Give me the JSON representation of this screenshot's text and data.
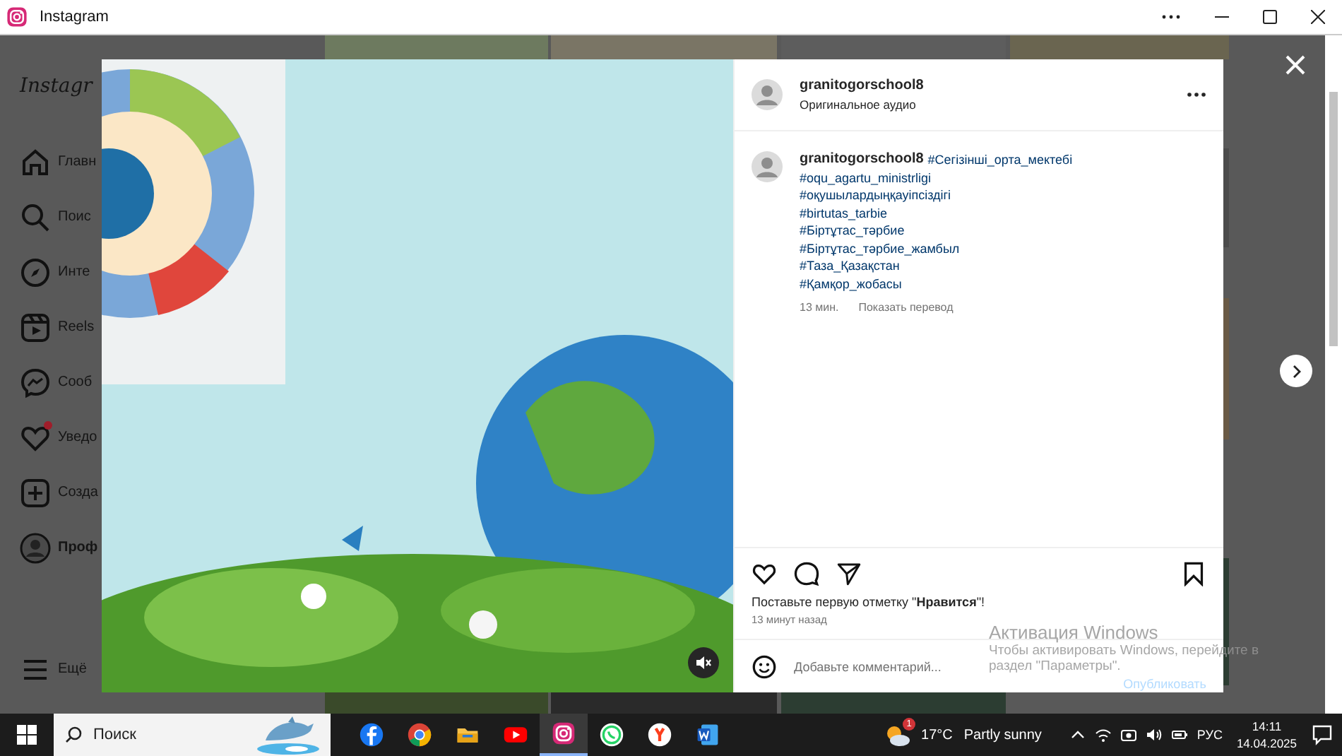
{
  "window": {
    "title": "Instagram"
  },
  "sidebar": {
    "logo": "Instagr",
    "items": [
      {
        "label": "Главн",
        "kind": "home",
        "selected": false,
        "dot": false
      },
      {
        "label": "Поис",
        "kind": "search",
        "selected": false,
        "dot": false
      },
      {
        "label": "Инте",
        "kind": "compass",
        "selected": false,
        "dot": false
      },
      {
        "label": "Reels",
        "kind": "reels",
        "selected": false,
        "dot": false
      },
      {
        "label": "Сооб",
        "kind": "messenger",
        "selected": false,
        "dot": false
      },
      {
        "label": "Уведо",
        "kind": "heart",
        "selected": false,
        "dot": true
      },
      {
        "label": "Созда",
        "kind": "plus",
        "selected": false,
        "dot": false
      },
      {
        "label": "Проф",
        "kind": "avatar",
        "selected": true,
        "dot": false
      }
    ],
    "more": "Ещё"
  },
  "post": {
    "author": "granitogorschool8",
    "audio": "Оригинальное аудио",
    "caption": {
      "username": "granitogorschool8",
      "hashtags": [
        "#Сегізінші_орта_мектебі",
        "#oqu_agartu_ministrligi",
        "#оқушылардыңқауіпсіздігі",
        "#birtutas_tarbie",
        "#Біртұтас_тәрбие",
        "#Біртұтас_тәрбие_жамбыл",
        "#Таза_Қазақстан",
        "#Қамқор_жобасы"
      ],
      "time": "13 мин.",
      "translate": "Показать перевод"
    },
    "likes": "Поставьте первую отметку \"**Нравится**\"!",
    "posted": "13 минут назад",
    "comment": {
      "placeholder": "Добавьте комментарий..."
    },
    "publish": "Опубликовать"
  },
  "watermark": {
    "title": "Активация Windows",
    "text": "Чтобы активировать Windows, перейдите в раздел \"Параметры\"."
  },
  "taskbar": {
    "search": {
      "placeholder": "Поиск"
    },
    "apps": [
      {
        "kind": "facebook",
        "selected": false
      },
      {
        "kind": "chrome",
        "selected": false
      },
      {
        "kind": "folder",
        "selected": false
      },
      {
        "kind": "youtube",
        "selected": false
      },
      {
        "kind": "instagram",
        "selected": true
      },
      {
        "kind": "whatsapp",
        "selected": false
      },
      {
        "kind": "yandex",
        "selected": false
      },
      {
        "kind": "word",
        "selected": false
      }
    ],
    "weather": {
      "badge": "1",
      "temp": "17°C",
      "text": "Partly sunny"
    },
    "language": "РУС",
    "time": "14:11",
    "date": "14.04.2025"
  }
}
